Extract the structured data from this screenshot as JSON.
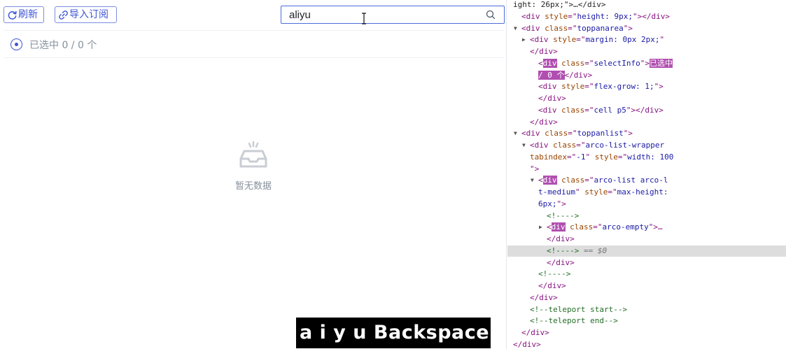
{
  "toolbar": {
    "refresh_label": "刷新",
    "import_label": "导入订阅"
  },
  "search": {
    "value": "aliyu",
    "placeholder": ""
  },
  "select_info": "已选中 0 / 0 个",
  "empty_text": "暂无数据",
  "keystroke_overlay": "a i y u Backspace",
  "colors": {
    "primary": "#3d55d6",
    "border": "#e5e6eb",
    "muted_text": "#86909c"
  },
  "devtools": {
    "lines": [
      {
        "indent": 0,
        "arrow": "",
        "parts": [
          [
            "x",
            "ight: 26px;\">…</div>"
          ]
        ]
      },
      {
        "indent": 1,
        "arrow": "",
        "parts": [
          [
            "t",
            "<div "
          ],
          [
            "a",
            "style"
          ],
          [
            "t",
            "=\""
          ],
          [
            "v",
            "height: 9px;"
          ],
          [
            "t",
            "\"></div>"
          ]
        ]
      },
      {
        "indent": 1,
        "arrow": "▼",
        "parts": [
          [
            "t",
            "<div "
          ],
          [
            "a",
            "class"
          ],
          [
            "t",
            "=\""
          ],
          [
            "v",
            "toppanarea"
          ],
          [
            "t",
            "\">"
          ]
        ]
      },
      {
        "indent": 2,
        "arrow": "▶",
        "parts": [
          [
            "t",
            "<div "
          ],
          [
            "a",
            "style"
          ],
          [
            "t",
            "=\""
          ],
          [
            "v",
            "margin: 0px 2px;"
          ],
          [
            "t",
            "\""
          ]
        ]
      },
      {
        "indent": 2,
        "arrow": "",
        "parts": [
          [
            "t",
            "</div>"
          ]
        ]
      },
      {
        "indent": 3,
        "arrow": "",
        "parts": [
          [
            "t",
            "<"
          ],
          [
            "hl",
            "div"
          ],
          [
            "t",
            " "
          ],
          [
            "a",
            "class"
          ],
          [
            "t",
            "=\""
          ],
          [
            "v",
            "selectInfo"
          ],
          [
            "t",
            "\">"
          ],
          [
            "hl",
            "已选中"
          ]
        ]
      },
      {
        "indent": 3,
        "arrow": "",
        "parts": [
          [
            "hl",
            "/ 0 个"
          ],
          [
            "t",
            "</div>"
          ]
        ]
      },
      {
        "indent": 3,
        "arrow": "",
        "parts": [
          [
            "t",
            "<div "
          ],
          [
            "a",
            "style"
          ],
          [
            "t",
            "=\""
          ],
          [
            "v",
            "flex-grow: 1;"
          ],
          [
            "t",
            "\">"
          ]
        ]
      },
      {
        "indent": 3,
        "arrow": "",
        "parts": [
          [
            "t",
            "</div>"
          ]
        ]
      },
      {
        "indent": 3,
        "arrow": "",
        "parts": [
          [
            "t",
            "<div "
          ],
          [
            "a",
            "class"
          ],
          [
            "t",
            "=\""
          ],
          [
            "v",
            "cell p5"
          ],
          [
            "t",
            "\"></div>"
          ]
        ]
      },
      {
        "indent": 2,
        "arrow": "",
        "parts": [
          [
            "t",
            "</div>"
          ]
        ]
      },
      {
        "indent": 1,
        "arrow": "▼",
        "parts": [
          [
            "t",
            "<div "
          ],
          [
            "a",
            "class"
          ],
          [
            "t",
            "=\""
          ],
          [
            "v",
            "toppanlist"
          ],
          [
            "t",
            "\">"
          ]
        ]
      },
      {
        "indent": 2,
        "arrow": "▼",
        "parts": [
          [
            "t",
            "<div "
          ],
          [
            "a",
            "class"
          ],
          [
            "t",
            "=\""
          ],
          [
            "v",
            "arco-list-wrapper"
          ]
        ]
      },
      {
        "indent": 2,
        "arrow": "",
        "parts": [
          [
            "a",
            "tabindex"
          ],
          [
            "t",
            "=\""
          ],
          [
            "v",
            "-1"
          ],
          [
            "t",
            "\" "
          ],
          [
            "a",
            "style"
          ],
          [
            "t",
            "=\""
          ],
          [
            "v",
            "width: 100"
          ]
        ]
      },
      {
        "indent": 2,
        "arrow": "",
        "parts": [
          [
            "t",
            "\">"
          ]
        ]
      },
      {
        "indent": 3,
        "arrow": "▼",
        "parts": [
          [
            "t",
            "<"
          ],
          [
            "hl",
            "div"
          ],
          [
            "t",
            " "
          ],
          [
            "a",
            "class"
          ],
          [
            "t",
            "=\""
          ],
          [
            "v",
            "arco-list arco-l"
          ]
        ]
      },
      {
        "indent": 3,
        "arrow": "",
        "parts": [
          [
            "v",
            "t-medium"
          ],
          [
            "t",
            "\" "
          ],
          [
            "a",
            "style"
          ],
          [
            "t",
            "=\""
          ],
          [
            "v",
            "max-height: "
          ]
        ]
      },
      {
        "indent": 3,
        "arrow": "",
        "parts": [
          [
            "v",
            "6px;"
          ],
          [
            "t",
            "\">"
          ]
        ]
      },
      {
        "indent": 4,
        "arrow": "",
        "parts": [
          [
            "c",
            "<!---->"
          ]
        ]
      },
      {
        "indent": 4,
        "arrow": "▶",
        "parts": [
          [
            "t",
            "<"
          ],
          [
            "hl",
            "div"
          ],
          [
            "t",
            " "
          ],
          [
            "a",
            "class"
          ],
          [
            "t",
            "=\""
          ],
          [
            "v",
            "arco-empty"
          ],
          [
            "t",
            "\">…"
          ]
        ]
      },
      {
        "indent": 4,
        "arrow": "",
        "parts": [
          [
            "t",
            "</div>"
          ]
        ]
      },
      {
        "indent": 4,
        "arrow": "",
        "selected": true,
        "parts": [
          [
            "c",
            "<!---->"
          ],
          [
            "m",
            " == $0"
          ]
        ]
      },
      {
        "indent": 4,
        "arrow": "",
        "parts": [
          [
            "t",
            "</div>"
          ]
        ]
      },
      {
        "indent": 3,
        "arrow": "",
        "parts": [
          [
            "c",
            "<!---->"
          ]
        ]
      },
      {
        "indent": 3,
        "arrow": "",
        "parts": [
          [
            "t",
            "</div>"
          ]
        ]
      },
      {
        "indent": 2,
        "arrow": "",
        "parts": [
          [
            "t",
            "</div>"
          ]
        ]
      },
      {
        "indent": 2,
        "arrow": "",
        "parts": [
          [
            "c",
            "<!--teleport start-->"
          ]
        ]
      },
      {
        "indent": 2,
        "arrow": "",
        "parts": [
          [
            "c",
            "<!--teleport end-->"
          ]
        ]
      },
      {
        "indent": 1,
        "arrow": "",
        "parts": [
          [
            "t",
            "</div>"
          ]
        ]
      },
      {
        "indent": 0,
        "arrow": "",
        "parts": [
          [
            "t",
            "</div>"
          ]
        ]
      }
    ]
  }
}
